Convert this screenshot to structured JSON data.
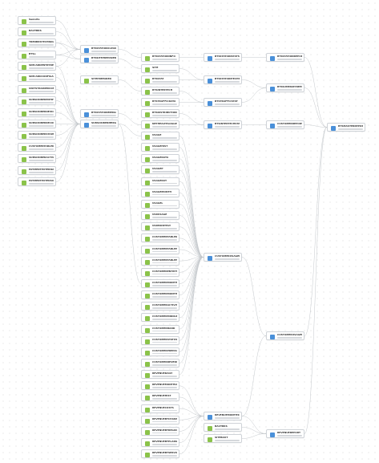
{
  "graph": {
    "sources": [
      "Samsite",
      "BAUTBRS",
      "TRENBRSTECHNOLOGY",
      "BTSo",
      "SIMCARDENTRYDETAIL",
      "SIMCARDCONFIGAMT",
      "UNITSTRAINERCONNECTED",
      "SUBSCRIBERENTRYS",
      "SUBSCRIBERDEVICES",
      "SUBSCRIBERRECORDS",
      "SUBSCRIBERSTARTERPACK",
      "CUSTOMERTABLEDATA",
      "SUBSCRIBERACTIVITYS",
      "PAYMENTEXTERNAL",
      "PAYMENTEXTENSIONS"
    ],
    "inputs": [
      "BTSSTATIONINFO",
      "SITE",
      "BTSSTAT",
      "BTSINTERTECH",
      "BTSTRAFFICDATA",
      "BTSDISTRIBUTIONPROD",
      "NETHEALTHLOGGER",
      "USAGE",
      "USAGEHIST",
      "USAGEDATA",
      "USAGEP",
      "USAGEDAY",
      "USAGEMONTH",
      "USAGEL",
      "USRUSAGE",
      "USRMONTHLY",
      "CUSTOMERTABLEDATA",
      "CUSTOMERTABLEHIST",
      "CUSTOMERTABLEPROD",
      "CUSTOMERENTRYS",
      "CUSTOMERMONTHLYS",
      "CUSTOMERMONTHSUM",
      "CUSTOMERACTIVITYS",
      "CUSTOMERMIDDLES",
      "CUSTOMERBAND",
      "CUSTOMERSTATUS",
      "CUSTOMERPREPAID",
      "CUSTOMERREVENUE",
      "REVENUEDAILY",
      "REVENUEMONTHLY",
      "REVENUEHIST",
      "REVENUECOSTS",
      "REVENUEBYCHANNEL",
      "REVENUEBYREGION",
      "REVENUEBYPLANS",
      "REVENUEBYSERVICE"
    ],
    "stage1": [
      "BTSSTATIONCLEAN",
      "BTSSITEPREPARED",
      "SITEPREPARED",
      "BTSSTATIONMERGED",
      "SUBSCRIBERMERGED"
    ],
    "stage3": [
      "BTSSTATIONSTATS",
      "BTSSTATIONTECHS",
      "BTSTRAFFICSTAT",
      "BTSINTERTECHSTAT",
      "CUSTOMERUSAGEPRE",
      "REVENUEMONTHSUM",
      "BAUTBRS",
      "SITEBAUT"
    ],
    "stage4": [
      "BTSSTATIONREPORT",
      "BTSSUMMARYREPORT",
      "CUSTOMERREPORT",
      "CUSTOMERUSAGEREPORT",
      "REVENUEREPORT"
    ],
    "final": [
      "BTSMASTERREPORT"
    ]
  }
}
